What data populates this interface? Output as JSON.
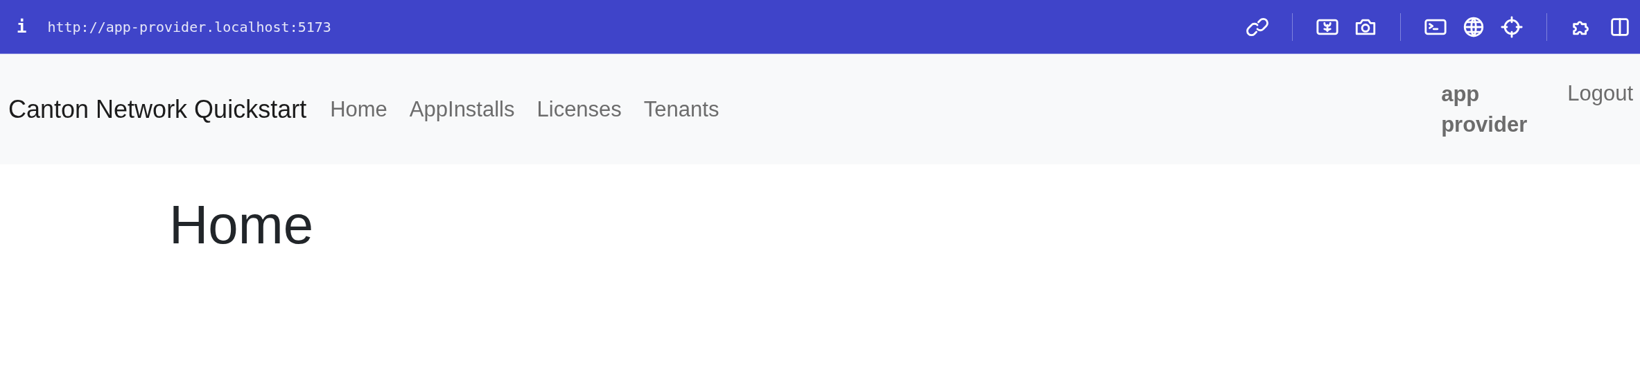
{
  "browser_bar": {
    "url": "http://app-provider.localhost:5173",
    "info_icon": "i"
  },
  "navbar": {
    "brand": "Canton Network Quickstart",
    "links": [
      {
        "label": "Home"
      },
      {
        "label": "AppInstalls"
      },
      {
        "label": "Licenses"
      },
      {
        "label": "Tenants"
      }
    ],
    "user": "app provider",
    "logout": "Logout"
  },
  "page": {
    "heading": "Home"
  }
}
